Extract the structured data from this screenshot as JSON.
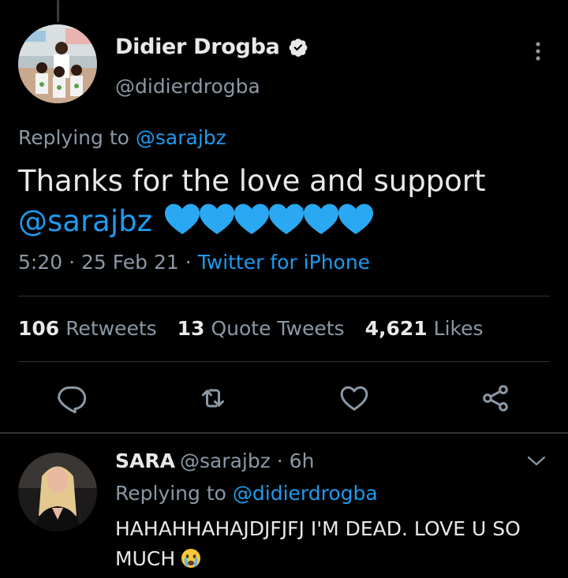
{
  "tweet": {
    "author_name": "Didier Drogba",
    "author_handle": "@didierdrogba",
    "replying_prefix": "Replying to ",
    "replying_to": "@sarajbz",
    "text_line1": "Thanks for the love and support",
    "text_mention": "@sarajbz",
    "heart_emoji_count": 6,
    "timestamp": "5:20 · 25 Feb 21 · ",
    "source": "Twitter for iPhone"
  },
  "stats": {
    "retweets_count": "106",
    "retweets_label": "Retweets",
    "quotes_count": "13",
    "quotes_label": "Quote Tweets",
    "likes_count": "4,621",
    "likes_label": "Likes"
  },
  "actions": [
    "reply-icon",
    "retweet-icon",
    "like-icon",
    "share-icon"
  ],
  "reply": {
    "author_name": "SARA",
    "author_handle": "@sarajbz",
    "time": " · 6h",
    "replying_prefix": "Replying to ",
    "replying_to": "@didierdrogba",
    "text": "HAHAHHAHAJDJFJFJ I'M DEAD. LOVE U SO MUCH"
  },
  "colors": {
    "background": "#000000",
    "link": "#1d9bf0",
    "secondary_text": "#8b98a5",
    "primary_text": "#e7e9ea",
    "heart_blue": "#2aa8f2"
  }
}
